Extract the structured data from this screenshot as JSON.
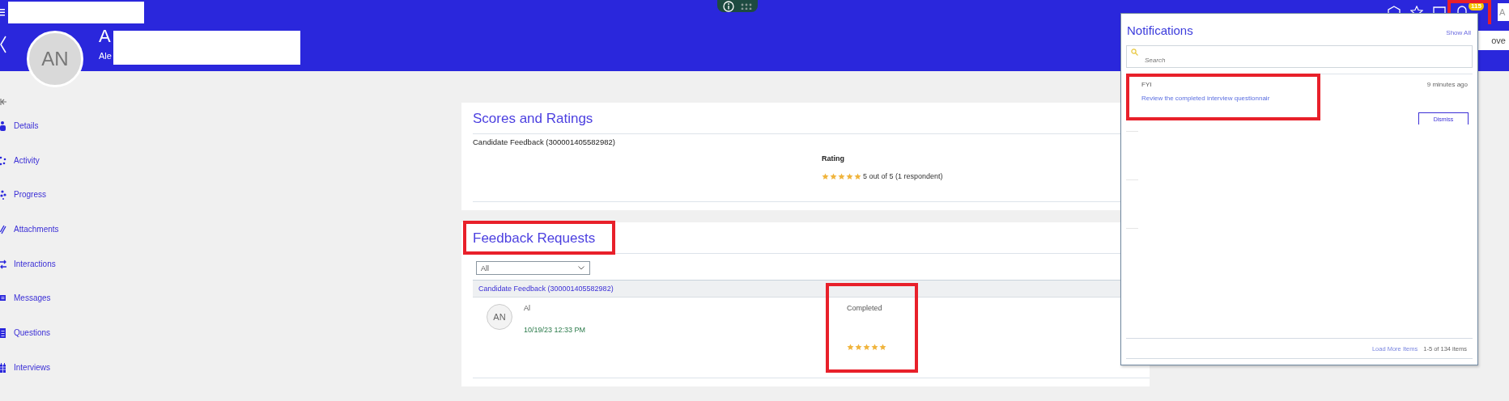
{
  "topbar": {
    "notification_count": "115",
    "bell_highlighted": true,
    "profile_label": "A"
  },
  "header": {
    "avatar_initials": "AN",
    "name": "A",
    "subtitle": "Ale",
    "button_label": "ove"
  },
  "sidebar": {
    "items": [
      {
        "label": "Details"
      },
      {
        "label": "Activity"
      },
      {
        "label": "Progress"
      },
      {
        "label": "Attachments"
      },
      {
        "label": "Interactions"
      },
      {
        "label": "Messages"
      },
      {
        "label": "Questions"
      },
      {
        "label": "Interviews"
      }
    ]
  },
  "scores": {
    "title": "Scores and Ratings",
    "subtitle": "Candidate Feedback (300001405582982)",
    "rating_label": "Rating",
    "stars": 5,
    "rating_text": "5 out of 5 (1 respondent)"
  },
  "feedback_requests": {
    "title": "Feedback Requests",
    "highlighted": true,
    "filter": "All",
    "group": "Candidate Feedback (300001405582982)",
    "requests": [
      {
        "avatar_initials": "AN",
        "name": "Al",
        "date": "10/19/23 12:33 PM",
        "status": "Completed",
        "stars": 5,
        "highlighted": true
      }
    ]
  },
  "notifications": {
    "title": "Notifications",
    "show_all": "Show All",
    "search": {
      "placeholder": "Search"
    },
    "items": [
      {
        "type": "FYI",
        "time": "9 minutes ago",
        "text": "Review the completed interview questionnair",
        "action": "Dismiss",
        "highlighted": true
      }
    ],
    "load_more": "Load More Items",
    "count": "1-5 of 134 items"
  }
}
